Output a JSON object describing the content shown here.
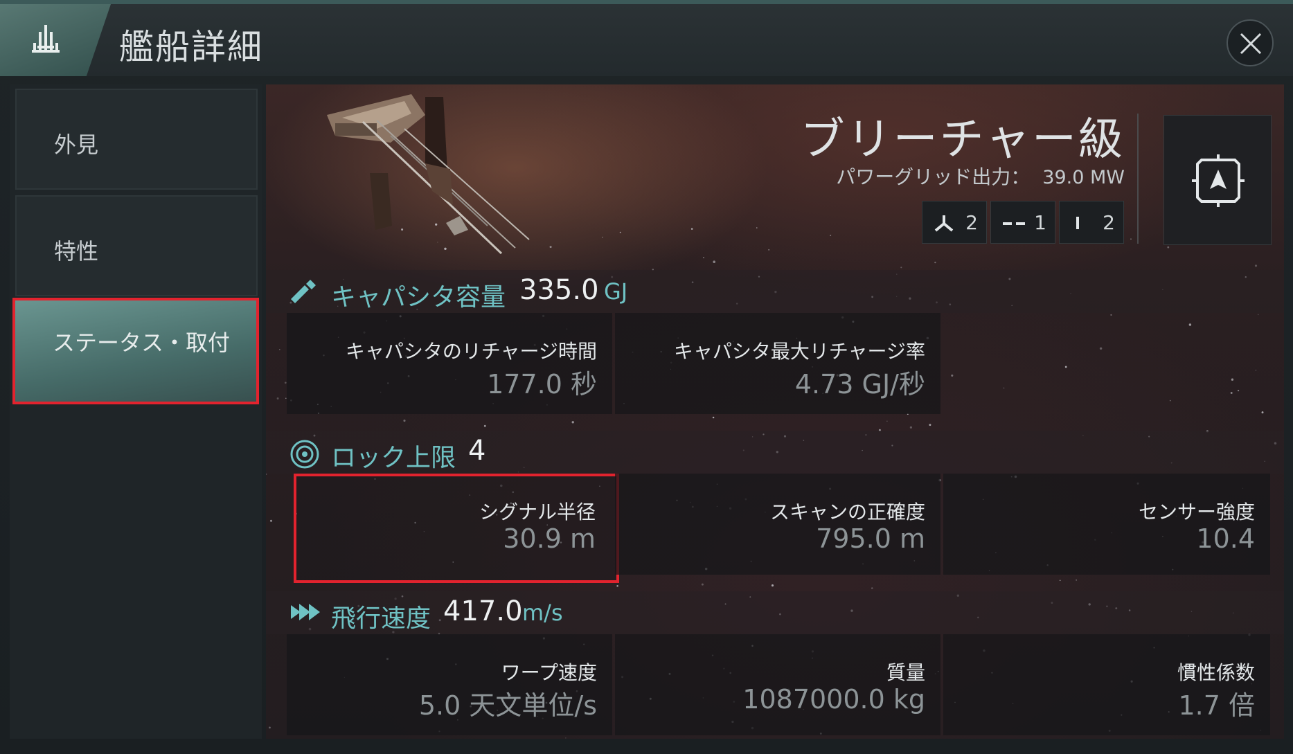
{
  "header": {
    "title": "艦船詳細",
    "logo_icon": "ship-class-icon",
    "close_icon": "close-icon"
  },
  "sidebar": {
    "items": [
      {
        "label": "外見",
        "active": false
      },
      {
        "label": "特性",
        "active": false
      },
      {
        "label": "ステータス・取付",
        "active": true
      }
    ]
  },
  "ship": {
    "name": "ブリーチャー級",
    "powergrid_label": "パワーグリッド出力：",
    "powergrid_value": "39.0 MW",
    "slots": [
      {
        "icon": "high-slot-icon",
        "count": "2"
      },
      {
        "icon": "mid-slot-icon",
        "count": "1"
      },
      {
        "icon": "low-slot-icon",
        "count": "2"
      }
    ],
    "target_icon": "ship-target-icon"
  },
  "capacitor": {
    "icon": "capacitor-icon",
    "title": "キャパシタ容量",
    "value": "335.0",
    "unit": "GJ",
    "stats": [
      {
        "label": "キャパシタのリチャージ時間",
        "value": "177.0 秒"
      },
      {
        "label": "キャパシタ最大リチャージ率",
        "value": "4.73 GJ/秒"
      }
    ]
  },
  "targeting": {
    "icon": "lock-target-icon",
    "title": "ロック上限",
    "value": "4",
    "stats": [
      {
        "label": "シグナル半径",
        "value": "30.9 m"
      },
      {
        "label": "スキャンの正確度",
        "value": "795.0 m"
      },
      {
        "label": "センサー強度",
        "value": "10.4"
      }
    ]
  },
  "navigation": {
    "icon": "speed-icon",
    "title": "飛行速度",
    "value": "417.0",
    "unit": "m/s",
    "stats": [
      {
        "label": "ワープ速度",
        "value": "5.0 天文単位/s"
      },
      {
        "label": "質量",
        "value": "1087000.0 kg"
      },
      {
        "label": "慣性係数",
        "value": "1.7 倍"
      }
    ]
  },
  "colors": {
    "accent_teal": "#6fc2c4",
    "highlight_red": "#e2232e",
    "active_tab": "#5f8a86"
  }
}
